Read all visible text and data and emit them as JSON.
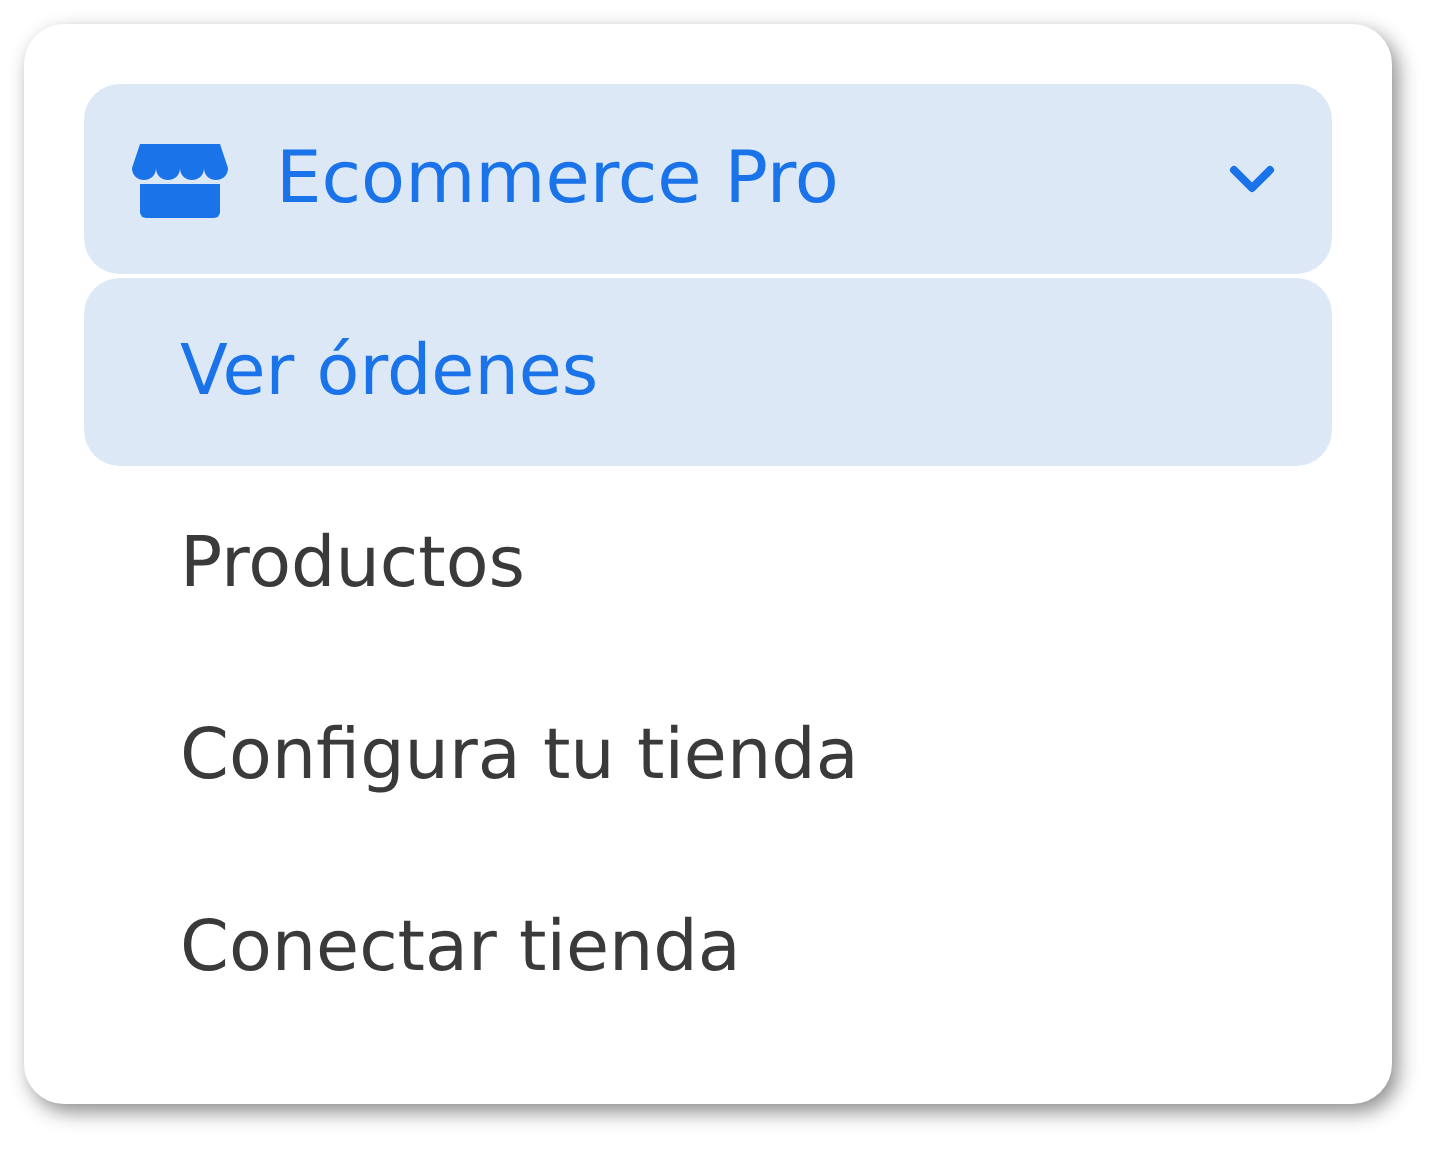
{
  "menu": {
    "title": "Ecommerce Pro",
    "expanded": true,
    "items": [
      {
        "label": "Ver órdenes",
        "selected": true
      },
      {
        "label": "Productos",
        "selected": false
      },
      {
        "label": "Configura tu tienda",
        "selected": false
      },
      {
        "label": "Conectar tienda",
        "selected": false
      }
    ]
  }
}
